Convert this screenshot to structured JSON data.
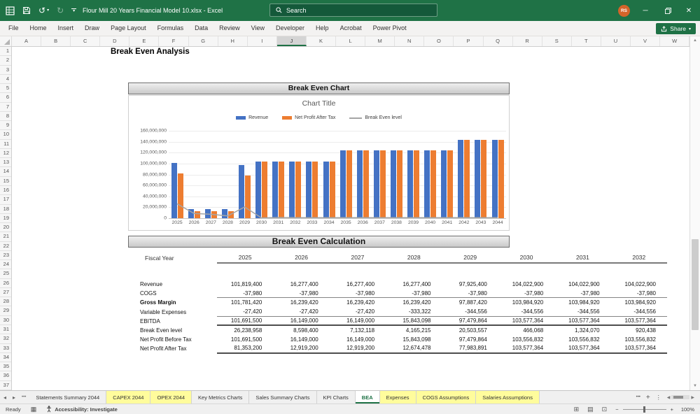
{
  "titlebar": {
    "title": "Flour Mill 20 Years Financial Model 10.xlsx  -  Excel",
    "search_placeholder": "Search",
    "avatar_initials": "RS"
  },
  "icons": {
    "minimize": "─",
    "close": "✕",
    "undo": "↺",
    "redo": "↻",
    "caret_down": "▾",
    "nav_left": "◂",
    "nav_right": "▸",
    "ellipsis": "•••",
    "plus": "+",
    "kebab": "⋮",
    "scroll_up": "▲",
    "scroll_down": "▼",
    "scroll_left": "◀",
    "scroll_right": "▶",
    "view_normal": "⊞",
    "view_layout": "▤",
    "view_break": "⊡",
    "zoom_out": "−",
    "zoom_in": "+",
    "macro": "▦"
  },
  "menubar": {
    "tabs": [
      "File",
      "Home",
      "Insert",
      "Draw",
      "Page Layout",
      "Formulas",
      "Data",
      "Review",
      "View",
      "Developer",
      "Help",
      "Acrobat",
      "Power Pivot"
    ],
    "share_label": "Share"
  },
  "grid": {
    "columns": [
      "A",
      "B",
      "C",
      "D",
      "E",
      "F",
      "G",
      "H",
      "I",
      "J",
      "K",
      "L",
      "M",
      "N",
      "O",
      "P",
      "Q",
      "R",
      "S",
      "T",
      "U",
      "V",
      "W"
    ],
    "selected_column": "J",
    "rows": [
      "1",
      "2",
      "3",
      "4",
      "5",
      "6",
      "7",
      "8",
      "9",
      "10",
      "11",
      "12",
      "13",
      "14",
      "15",
      "16",
      "17",
      "18",
      "19",
      "20",
      "21",
      "22",
      "23",
      "24",
      "25",
      "26",
      "27",
      "28",
      "29",
      "30",
      "31",
      "32",
      "33",
      "34",
      "35",
      "36",
      "37"
    ],
    "sheet_title": "Break Even Analysis"
  },
  "chart_section": {
    "header": "Break Even Chart"
  },
  "chart_data": {
    "type": "bar",
    "title": "Chart Title",
    "categories": [
      "2025",
      "2026",
      "2027",
      "2028",
      "2029",
      "2030",
      "2031",
      "2032",
      "2033",
      "2034",
      "2035",
      "2036",
      "2037",
      "2038",
      "2039",
      "2040",
      "2041",
      "2042",
      "2043",
      "2044"
    ],
    "series": [
      {
        "name": "Revenue",
        "kind": "bar",
        "color": "#4472C4",
        "values": [
          101819400,
          16277400,
          16277400,
          16277400,
          97925400,
          104022900,
          104022900,
          104022900,
          104022900,
          104022900,
          124000000,
          124000000,
          124000000,
          124000000,
          124000000,
          124000000,
          124000000,
          143500000,
          143500000,
          143500000
        ]
      },
      {
        "name": "Net Profit After Tax",
        "kind": "bar",
        "color": "#ED7D31",
        "values": [
          81353200,
          12919200,
          12919200,
          12674478,
          77983891,
          103577364,
          103577364,
          103577364,
          103577364,
          103577364,
          123600000,
          123600000,
          123600000,
          123600000,
          123600000,
          123600000,
          123600000,
          143000000,
          143000000,
          143000000
        ]
      },
      {
        "name": "Break Even level",
        "kind": "line",
        "color": "#A5A5A5",
        "values": [
          26238958,
          8598400,
          7132118,
          4165215,
          20503557,
          466068,
          1324070,
          920438,
          900000,
          900000,
          900000,
          900000,
          900000,
          900000,
          900000,
          900000,
          900000,
          900000,
          900000,
          900000
        ]
      }
    ],
    "ylim": [
      0,
      160000000
    ],
    "ytick_step": 20000000,
    "legend_position": "top",
    "grid": true,
    "xlabel": "",
    "ylabel": ""
  },
  "calc_section": {
    "header": "Break Even Calculation",
    "fiscal_year_label": "Fiscal Year",
    "years": [
      "2025",
      "2026",
      "2027",
      "2028",
      "2029",
      "2030",
      "2031",
      "2032"
    ],
    "rows": [
      {
        "label": "Revenue",
        "bold": false,
        "rule_below": "none",
        "values": [
          "101,819,400",
          "16,277,400",
          "16,277,400",
          "16,277,400",
          "97,925,400",
          "104,022,900",
          "104,022,900",
          "104,022,900"
        ]
      },
      {
        "label": "COGS",
        "bold": false,
        "rule_below": "thin",
        "values": [
          "-37,980",
          "-37,980",
          "-37,980",
          "-37,980",
          "-37,980",
          "-37,980",
          "-37,980",
          "-37,980"
        ]
      },
      {
        "label": "Gross Margin",
        "bold": true,
        "rule_below": "none",
        "values": [
          "101,781,420",
          "16,239,420",
          "16,239,420",
          "16,239,420",
          "97,887,420",
          "103,984,920",
          "103,984,920",
          "103,984,920"
        ]
      },
      {
        "label": "Variable Expenses",
        "bold": false,
        "rule_below": "thin",
        "values": [
          "-27,420",
          "-27,420",
          "-27,420",
          "-333,322",
          "-344,556",
          "-344,556",
          "-344,556",
          "-344,556"
        ]
      },
      {
        "label": "EBITDA",
        "bold": false,
        "rule_below": "thick",
        "values": [
          "101,691,500",
          "16,149,000",
          "16,149,000",
          "15,843,098",
          "97,479,864",
          "103,577,364",
          "103,577,364",
          "103,577,364"
        ]
      },
      {
        "label": "Break Even level",
        "bold": false,
        "rule_below": "none",
        "values": [
          "26,238,958",
          "8,598,400",
          "7,132,118",
          "4,165,215",
          "20,503,557",
          "466,068",
          "1,324,070",
          "920,438"
        ]
      },
      {
        "label": "Net Profit Before Tax",
        "bold": false,
        "rule_below": "none",
        "values": [
          "101,691,500",
          "16,149,000",
          "16,149,000",
          "15,843,098",
          "97,479,864",
          "103,556,832",
          "103,556,832",
          "103,556,832"
        ]
      },
      {
        "label": "Net Profit After Tax",
        "bold": false,
        "rule_below": "thick",
        "values": [
          "81,353,200",
          "12,919,200",
          "12,919,200",
          "12,674,478",
          "77,983,891",
          "103,577,364",
          "103,577,364",
          "103,577,364"
        ]
      }
    ]
  },
  "tabbar": {
    "tabs": [
      {
        "label": "Statements Summary 2044",
        "highlight": false,
        "active": false
      },
      {
        "label": "CAPEX 2044",
        "highlight": true,
        "active": false
      },
      {
        "label": "OPEX 2044",
        "highlight": true,
        "active": false
      },
      {
        "label": "Key Metrics Charts",
        "highlight": false,
        "active": false
      },
      {
        "label": "Sales Summary Charts",
        "highlight": false,
        "active": false
      },
      {
        "label": "KPI Charts",
        "highlight": false,
        "active": false
      },
      {
        "label": "BEA",
        "highlight": false,
        "active": true
      },
      {
        "label": "Expenses",
        "highlight": true,
        "active": false
      },
      {
        "label": "COGS Assumptions",
        "highlight": true,
        "active": false
      },
      {
        "label": "Salaries Assumptions",
        "highlight": true,
        "active": false
      }
    ],
    "highlight_color": "#FFFC9C",
    "active_color": "#1E7145"
  },
  "statusbar": {
    "mode": "Ready",
    "accessibility": "Accessibility: Investigate",
    "zoom": "100%"
  }
}
